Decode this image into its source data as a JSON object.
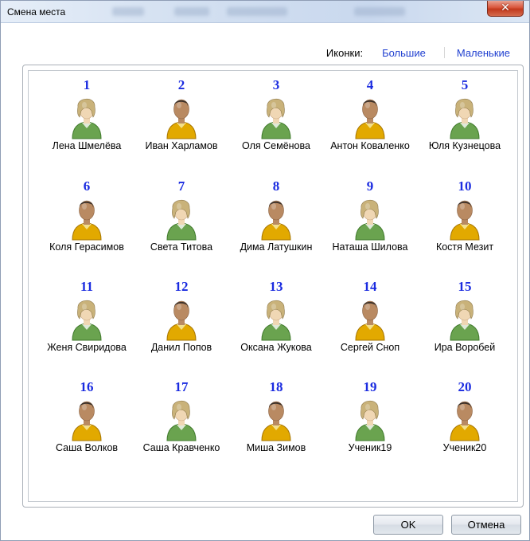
{
  "window": {
    "title": "Смена места"
  },
  "icon_size": {
    "label": "Иконки:",
    "large": "Большие",
    "small": "Маленькие"
  },
  "seats": [
    {
      "number": "1",
      "name": "Лена Шмелёва",
      "gender": "female"
    },
    {
      "number": "2",
      "name": "Иван Харламов",
      "gender": "male"
    },
    {
      "number": "3",
      "name": "Оля Семёнова",
      "gender": "female"
    },
    {
      "number": "4",
      "name": "Антон Коваленко",
      "gender": "male"
    },
    {
      "number": "5",
      "name": "Юля Кузнецова",
      "gender": "female"
    },
    {
      "number": "6",
      "name": "Коля Герасимов",
      "gender": "male"
    },
    {
      "number": "7",
      "name": "Света Титова",
      "gender": "female"
    },
    {
      "number": "8",
      "name": "Дима Латушкин",
      "gender": "male"
    },
    {
      "number": "9",
      "name": "Наташа Шилова",
      "gender": "female"
    },
    {
      "number": "10",
      "name": "Костя Мезит",
      "gender": "male"
    },
    {
      "number": "11",
      "name": "Женя Свиридова",
      "gender": "female"
    },
    {
      "number": "12",
      "name": "Данил Попов",
      "gender": "male"
    },
    {
      "number": "13",
      "name": "Оксана Жукова",
      "gender": "female"
    },
    {
      "number": "14",
      "name": "Сергей Сноп",
      "gender": "male"
    },
    {
      "number": "15",
      "name": "Ира Воробей",
      "gender": "female"
    },
    {
      "number": "16",
      "name": "Саша Волков",
      "gender": "male"
    },
    {
      "number": "17",
      "name": "Саша Кравченко",
      "gender": "female"
    },
    {
      "number": "18",
      "name": "Миша Зимов",
      "gender": "male"
    },
    {
      "number": "19",
      "name": "Ученик19",
      "gender": "female"
    },
    {
      "number": "20",
      "name": "Ученик20",
      "gender": "male"
    }
  ],
  "buttons": {
    "ok": "OK",
    "cancel": "Отмена"
  }
}
